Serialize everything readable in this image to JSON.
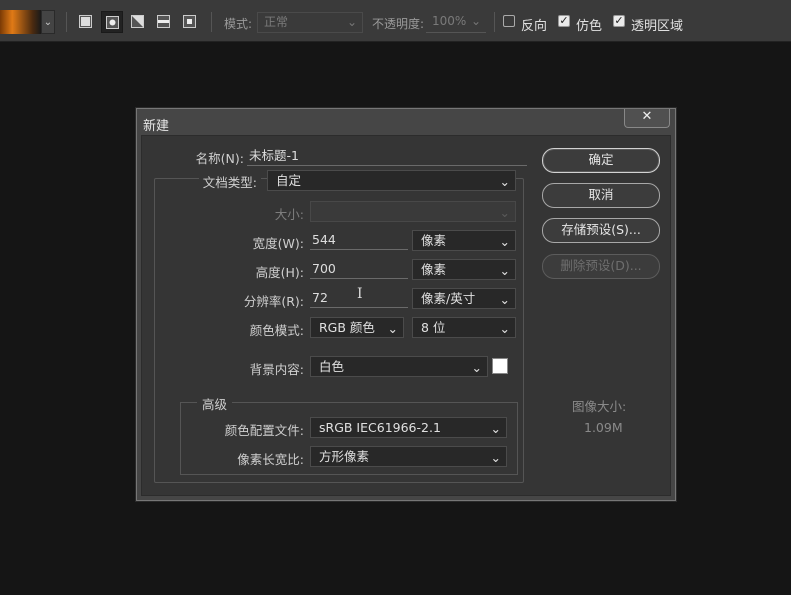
{
  "toolbar": {
    "mode_label": "模式:",
    "mode_value": "正常",
    "opacity_label": "不透明度:",
    "opacity_value": "100%",
    "reverse_label": "反向",
    "dither_label": "仿色",
    "transparency_label": "透明区域",
    "reverse_checked": false,
    "dither_checked": true,
    "transparency_checked": true
  },
  "dialog": {
    "title": "新建",
    "close_label": "✕",
    "name_label": "名称(N):",
    "name_value": "未标题-1",
    "doc_type_label": "文档类型:",
    "doc_type_value": "自定",
    "size_label": "大小:",
    "size_value": "",
    "width_label": "宽度(W):",
    "width_value": "544",
    "width_unit": "像素",
    "height_label": "高度(H):",
    "height_value": "700",
    "height_unit": "像素",
    "resolution_label": "分辨率(R):",
    "resolution_value": "72",
    "resolution_unit": "像素/英寸",
    "color_mode_label": "颜色模式:",
    "color_mode_value": "RGB 颜色",
    "bit_depth_value": "8 位",
    "background_label": "背景内容:",
    "background_value": "白色",
    "background_color": "#ffffff",
    "advanced_label": "高级",
    "profile_label": "颜色配置文件:",
    "profile_value": "sRGB IEC61966-2.1",
    "aspect_label": "像素长宽比:",
    "aspect_value": "方形像素",
    "image_size_label": "图像大小:",
    "image_size_value": "1.09M",
    "ok_label": "确定",
    "cancel_label": "取消",
    "save_preset_label": "存储预设(S)...",
    "delete_preset_label": "删除预设(D)..."
  },
  "colors": {
    "app_bg": "#151515",
    "toolbar_bg": "#3a3a3a",
    "dialog_bg": "#353535",
    "gradient_accent": "#e07a16"
  }
}
